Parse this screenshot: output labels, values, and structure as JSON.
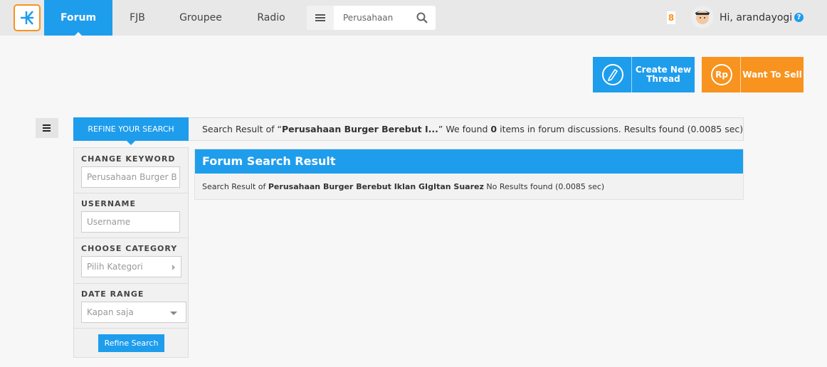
{
  "nav": {
    "items": [
      {
        "label": "Forum",
        "active": true
      },
      {
        "label": "FJB",
        "active": false
      },
      {
        "label": "Groupee",
        "active": false
      },
      {
        "label": "Radio",
        "active": false
      }
    ],
    "search_value": "Perusahaan B",
    "notification_count": "8",
    "greeting": "Hi, arandayogi",
    "help_glyph": "?"
  },
  "actions": {
    "create_thread_label": "Create New Thread",
    "want_to_sell_label": "Want To Sell",
    "rp_glyph": "Rp"
  },
  "refine": {
    "tab_label": "REFINE YOUR SEARCH",
    "summary_prefix": "Search Result of “",
    "summary_query": "Perusahaan Burger Berebut I...",
    "summary_mid": "” We found ",
    "summary_count": "0",
    "summary_suffix": " items in forum discussions. Results found (0.0085 sec)"
  },
  "filters": {
    "keyword_label": "CHANGE KEYWORD",
    "keyword_value": "Perusahaan Burger B",
    "username_label": "USERNAME",
    "username_placeholder": "Username",
    "category_label": "CHOOSE CATEGORY",
    "category_value": "Pilih Kategori",
    "date_label": "DATE RANGE",
    "date_value": "Kapan saja",
    "refine_button": "Refine Search"
  },
  "results": {
    "title": "Forum Search Result",
    "body_prefix": "Search Result of ",
    "body_query": "Perusahaan Burger Berebut Iklan GIgItan Suarez",
    "body_suffix": " No Results found (0.0085 sec)"
  },
  "colors": {
    "primary_blue": "#1e9ded",
    "accent_orange": "#f7931e"
  }
}
